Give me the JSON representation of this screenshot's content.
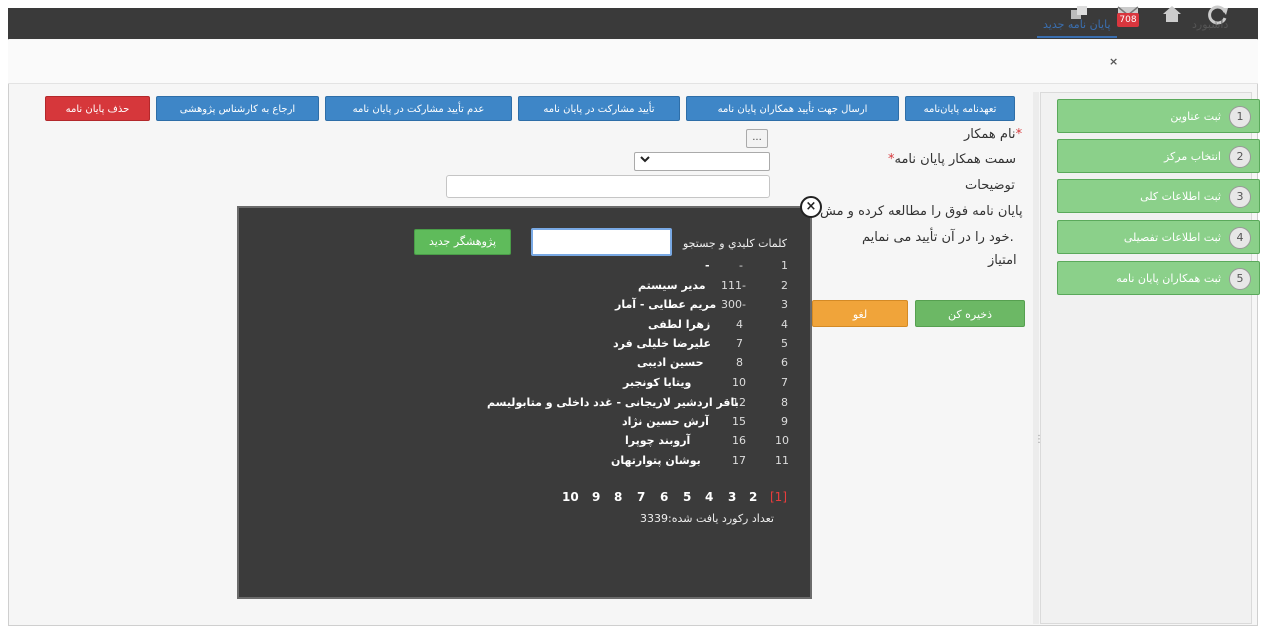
{
  "topbar": {
    "icons": [
      "windows-icon",
      "mail-icon",
      "home-icon",
      "refresh-icon"
    ],
    "badge": "708"
  },
  "tabs": [
    {
      "label": "داشبورد"
    },
    {
      "label": "پایان نامه جدید"
    }
  ],
  "tab_close": "×",
  "sidebar": {
    "steps": [
      {
        "num": "1",
        "label": "ثبت عناوین"
      },
      {
        "num": "2",
        "label": "انتخاب مرکز"
      },
      {
        "num": "3",
        "label": "ثبت اطلاعات کلی"
      },
      {
        "num": "4",
        "label": "ثبت اطلاعات تفصیلی"
      },
      {
        "num": "5",
        "label": "ثبت همکاران پایان نامه"
      }
    ]
  },
  "actions": [
    {
      "label": "تعهدنامه پایان‌نامه"
    },
    {
      "label": "ارسال جهت تأیید همکاران پایان نامه"
    },
    {
      "label": "تأیید مشارکت در پایان نامه"
    },
    {
      "label": "عدم تأیید مشارکت در پایان نامه"
    },
    {
      "label": "ارجاع به کارشناس پژوهشی"
    },
    {
      "label": "حذف پایان نامه"
    }
  ],
  "form": {
    "name_label": "نام همکار",
    "role_label": "سمت همکار پایان نامه",
    "required_mark": "*",
    "desc_label": "توضیحات",
    "notice_line1": "پایان نامه فوق را مطالعه کرده و مش",
    "notice_line2": "خود را در آن تأیید می نمایم.",
    "score_label": "امتیاز",
    "browse_label": "...",
    "save_label": "ذخیره کن",
    "cancel_label": "لغو"
  },
  "modal": {
    "search_label": "کلمات کلیدي و جستجو",
    "search_value": "",
    "new_button": "پژوهشگر جدید",
    "close": "×",
    "rows": [
      {
        "idx": "1",
        "code": "-",
        "name": "-"
      },
      {
        "idx": "2",
        "code": "111-",
        "name": "مدیر سیستم"
      },
      {
        "idx": "3",
        "code": "300-",
        "name": "مریم عطایی - آمار"
      },
      {
        "idx": "4",
        "code": "4",
        "name": "زهرا لطفی"
      },
      {
        "idx": "5",
        "code": "7",
        "name": "علیرضا خلیلی فرد"
      },
      {
        "idx": "6",
        "code": "8",
        "name": "حسین ادیبی"
      },
      {
        "idx": "7",
        "code": "10",
        "name": "ویتایا کونجبر"
      },
      {
        "idx": "8",
        "code": "12",
        "name": "باقر اردشیر لاریجانی - غدد داخلی و متابولیسم"
      },
      {
        "idx": "9",
        "code": "15",
        "name": "آرش حسین نژاد"
      },
      {
        "idx": "10",
        "code": "16",
        "name": "آروبند چوپرا"
      },
      {
        "idx": "11",
        "code": "17",
        "name": "بوشان پتوارتهان"
      }
    ],
    "pages": [
      "[1]",
      "2",
      "3",
      "4",
      "5",
      "6",
      "7",
      "8",
      "9",
      "10"
    ],
    "count_text": "تعداد رکورد یافت شده:3339"
  }
}
